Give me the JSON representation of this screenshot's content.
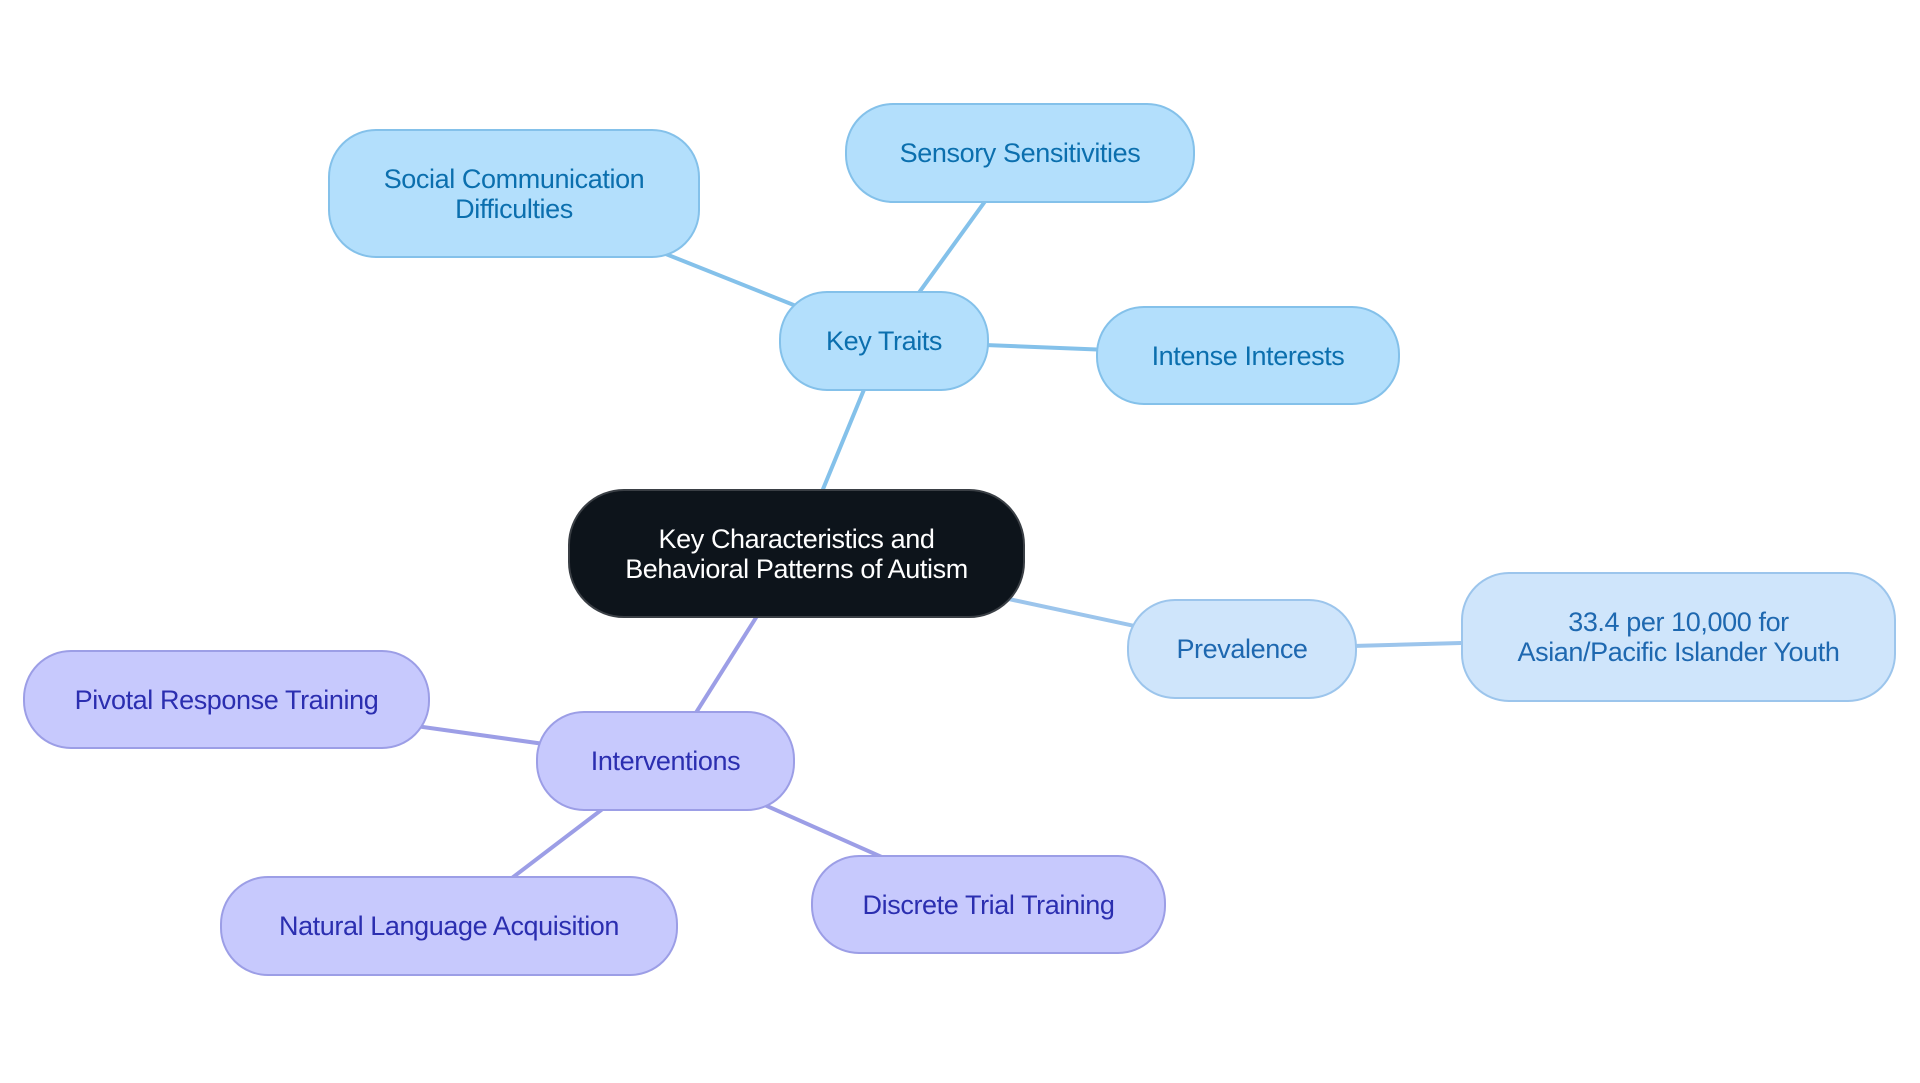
{
  "diagram": {
    "type": "mind-map",
    "colors": {
      "root_fill": "#0d141b",
      "root_text": "#ffffff",
      "traits_fill": "#b3dffc",
      "traits_stroke": "#84c1ea",
      "traits_text": "#0b6fae",
      "prevalence_fill": "#cfe5fb",
      "prevalence_stroke": "#9cc5ec",
      "prevalence_text": "#1e68b0",
      "interventions_fill": "#c7c9fd",
      "interventions_stroke": "#9c9ee6",
      "interventions_text": "#2b2eb0"
    },
    "root": {
      "id": "root",
      "label": "Key Characteristics and\nBehavioral Patterns of Autism"
    },
    "branches": [
      {
        "id": "key-traits",
        "label": "Key Traits",
        "theme": "blue",
        "children": [
          {
            "id": "social",
            "label": "Social Communication\nDifficulties"
          },
          {
            "id": "sensory",
            "label": "Sensory Sensitivities"
          },
          {
            "id": "intense",
            "label": "Intense Interests"
          }
        ]
      },
      {
        "id": "prevalence",
        "label": "Prevalence",
        "theme": "lblue",
        "children": [
          {
            "id": "rate",
            "label": "33.4 per 10,000 for\nAsian/Pacific Islander Youth"
          }
        ]
      },
      {
        "id": "interventions",
        "label": "Interventions",
        "theme": "purple",
        "children": [
          {
            "id": "pivotal",
            "label": "Pivotal Response Training"
          },
          {
            "id": "natural",
            "label": "Natural Language Acquisition"
          },
          {
            "id": "discrete",
            "label": "Discrete Trial Training"
          }
        ]
      }
    ]
  }
}
